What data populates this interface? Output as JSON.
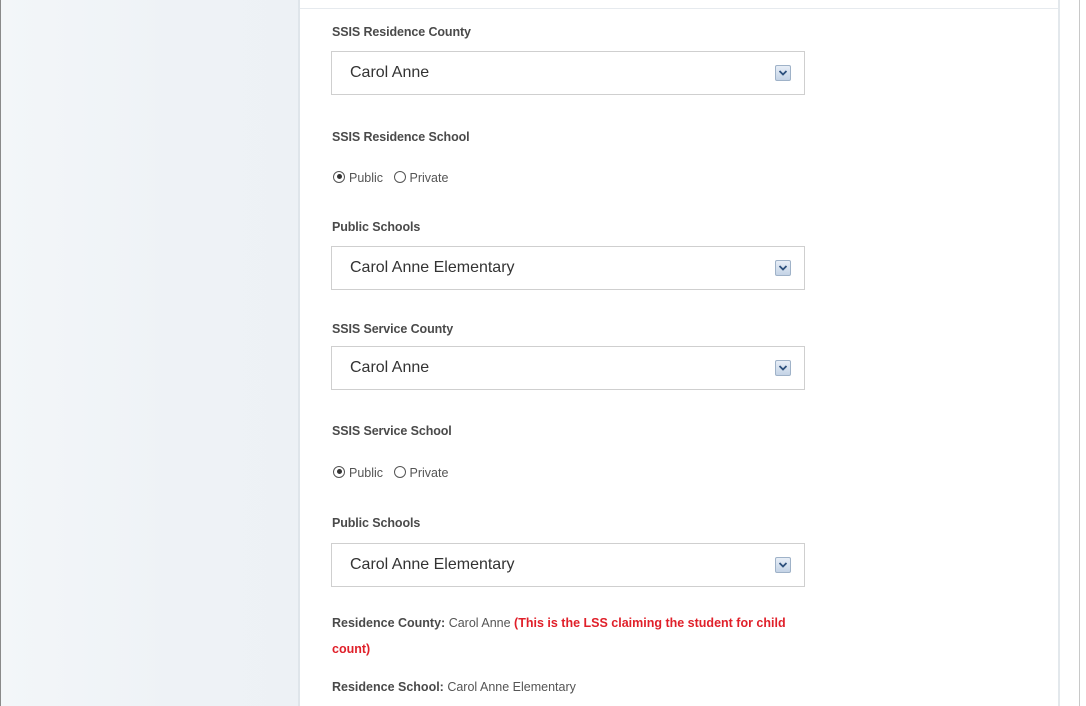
{
  "form": {
    "residence_county": {
      "label": "SSIS Residence County",
      "value": "Carol Anne"
    },
    "residence_school": {
      "label": "SSIS Residence School",
      "options": [
        "Public",
        "Private"
      ],
      "selected": "Public"
    },
    "residence_public_schools": {
      "label": "Public Schools",
      "value": "Carol Anne Elementary"
    },
    "service_county": {
      "label": "SSIS Service County",
      "value": "Carol Anne"
    },
    "service_school": {
      "label": "SSIS Service School",
      "options": [
        "Public",
        "Private"
      ],
      "selected": "Public"
    },
    "service_public_schools": {
      "label": "Public Schools",
      "value": "Carol Anne Elementary"
    }
  },
  "summary": {
    "residence_county_key": "Residence County:",
    "residence_county_value": "Carol Anne",
    "residence_county_note_line1": "(This is the LSS claiming the student for child",
    "residence_county_note_line2": "count)",
    "residence_school_key": "Residence School:",
    "residence_school_value": "Carol Anne Elementary"
  },
  "colors": {
    "note_red": "#e0202a",
    "label_text": "#4a4a4a",
    "select_border": "#cfcfcf",
    "left_panel_bg": "#eef2f6"
  },
  "icons": {
    "dropdown": "chevron-down-icon",
    "radio_checked": "radio-checked-icon",
    "radio_unchecked": "radio-unchecked-icon"
  }
}
